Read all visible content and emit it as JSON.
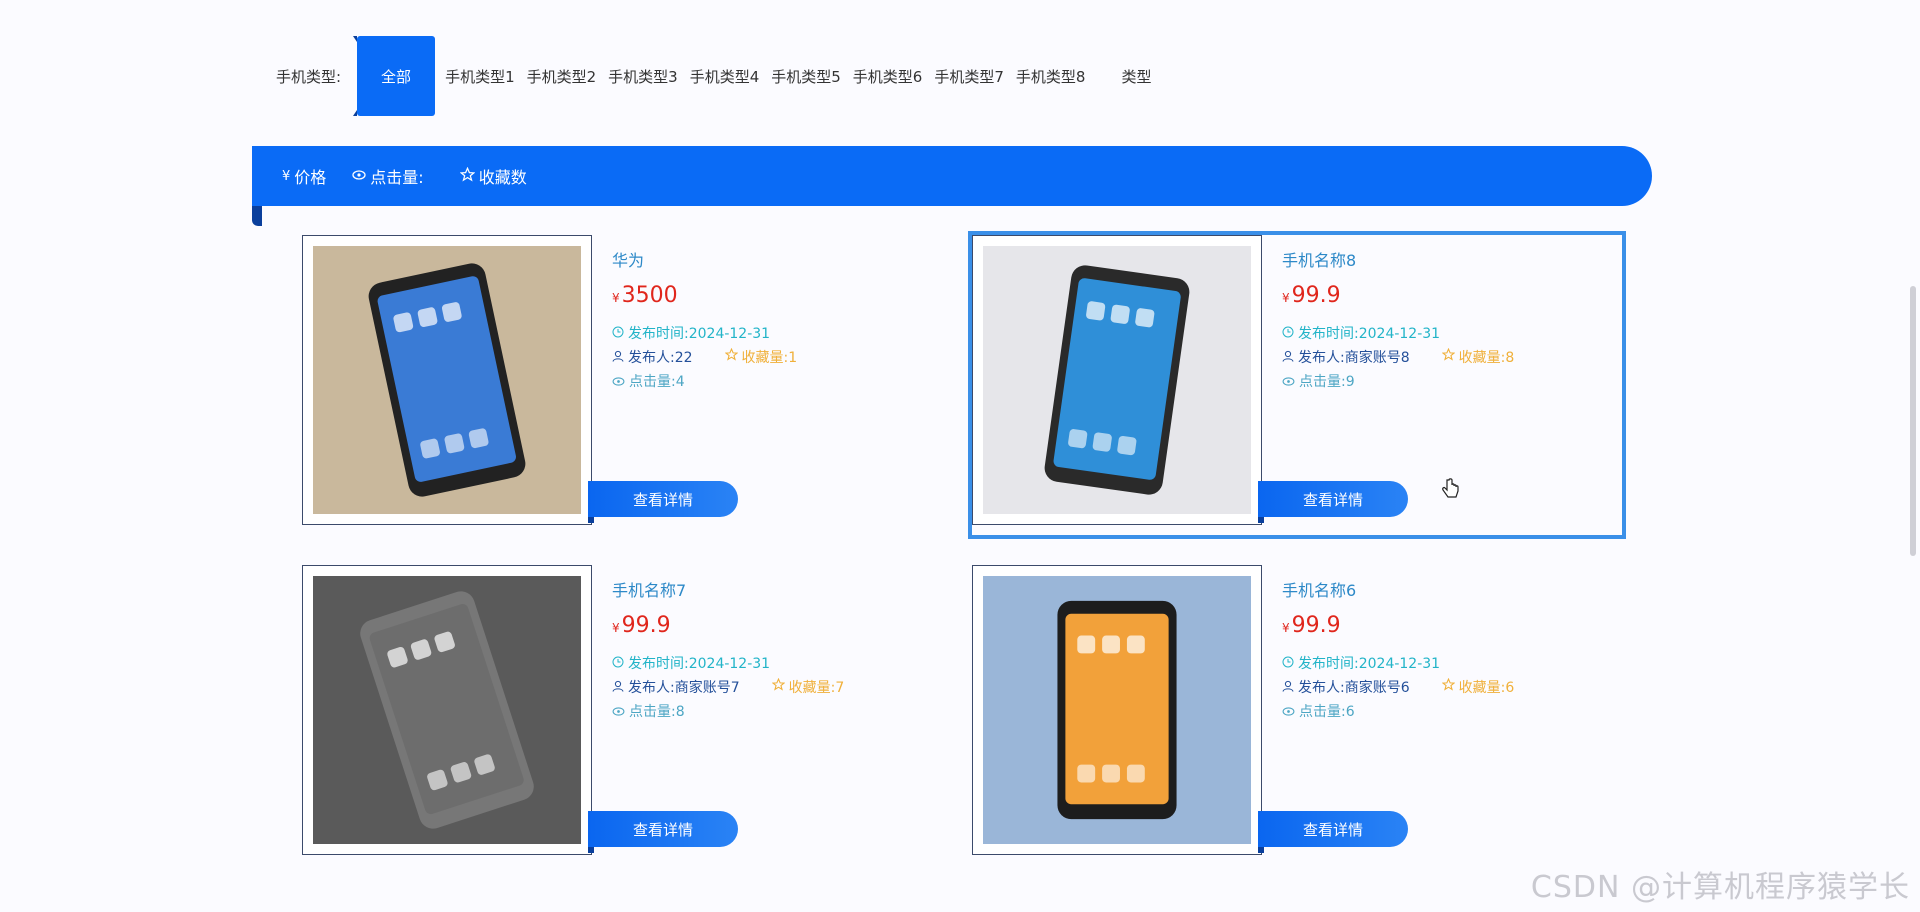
{
  "filter": {
    "label": "手机类型:",
    "items": [
      "全部",
      "手机类型1",
      "手机类型2",
      "手机类型3",
      "手机类型4",
      "手机类型5",
      "手机类型6",
      "手机类型7",
      "手机类型8"
    ],
    "extra": "类型"
  },
  "sort": {
    "price": "价格",
    "price_icon": "¥",
    "clicks": "点击量:",
    "favorites": "收藏数"
  },
  "labels": {
    "time_prefix": "发布时间:",
    "user_prefix": "发布人:",
    "fav_prefix": "收藏量:",
    "click_prefix": "点击量:",
    "yen": "¥",
    "detail": "查看详情"
  },
  "products": [
    {
      "name": "华为",
      "price": "3500",
      "date": "2024-12-31",
      "user": "22",
      "fav": "1",
      "clicks": "4"
    },
    {
      "name": "手机名称8",
      "price": "99.9",
      "date": "2024-12-31",
      "user": "商家账号8",
      "fav": "8",
      "clicks": "9"
    },
    {
      "name": "手机名称7",
      "price": "99.9",
      "date": "2024-12-31",
      "user": "商家账号7",
      "fav": "7",
      "clicks": "8"
    },
    {
      "name": "手机名称6",
      "price": "99.9",
      "date": "2024-12-31",
      "user": "商家账号6",
      "fav": "6",
      "clicks": "6"
    }
  ],
  "watermark": "CSDN @计算机程序猿学长",
  "colors": {
    "primary": "#0a6bf6",
    "price": "#e0261c",
    "fav": "#f0b03a",
    "time": "#22b4c8"
  }
}
